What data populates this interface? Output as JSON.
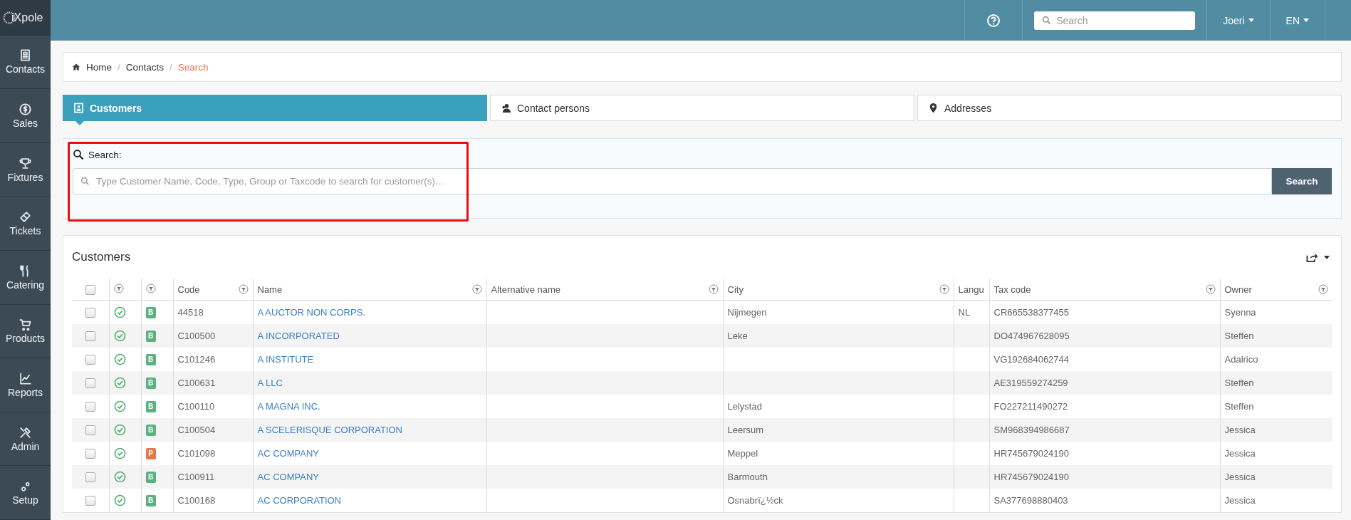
{
  "sidebar": {
    "logo": "iXpole",
    "items": [
      {
        "label": "Contacts"
      },
      {
        "label": "Sales"
      },
      {
        "label": "Fixtures"
      },
      {
        "label": "Tickets"
      },
      {
        "label": "Catering"
      },
      {
        "label": "Products"
      },
      {
        "label": "Reports"
      },
      {
        "label": "Admin"
      },
      {
        "label": "Setup"
      }
    ]
  },
  "topbar": {
    "search_placeholder": "Search",
    "user": "Joeri",
    "language": "EN"
  },
  "breadcrumb": [
    {
      "label": "Home",
      "selected": false
    },
    {
      "separator": "/",
      "label": "Contacts",
      "selected": false
    },
    {
      "separator": "/",
      "label": "Search",
      "selected": true
    }
  ],
  "tabs": [
    {
      "label": "Customers",
      "selected": true
    },
    {
      "label": "Contact persons",
      "selected": false
    },
    {
      "label": "Addresses",
      "selected": false
    }
  ],
  "search": {
    "label": "Search:",
    "placeholder": "Type Customer Name, Code, Type, Group or Taxcode to search for customer(s)...",
    "button": "Search"
  },
  "table": {
    "title": "Customers",
    "header_checked": false,
    "columns": [
      "Code",
      "Name",
      "Alternative name",
      "City",
      "Langu",
      "Tax code",
      "Owner"
    ],
    "rows": [
      {
        "checked": false,
        "type": {
          "label": "B",
          "color": "#5cb27f"
        },
        "code": "44518",
        "name": "A AUCTOR NON CORPS.",
        "alternative_name": "",
        "city": "Nijmegen",
        "language": "NL",
        "tax_code": "CR665538377455",
        "owner": "Syenna"
      },
      {
        "checked": false,
        "type": {
          "label": "B",
          "color": "#5cb27f"
        },
        "code": "C100500",
        "name": "A INCORPORATED",
        "alternative_name": "",
        "city": "Leke",
        "language": "",
        "tax_code": "DO474967628095",
        "owner": "Steffen"
      },
      {
        "checked": false,
        "type": {
          "label": "B",
          "color": "#5cb27f"
        },
        "code": "C101246",
        "name": "A INSTITUTE",
        "alternative_name": "",
        "city": "",
        "language": "",
        "tax_code": "VG192684062744",
        "owner": "Adalrico"
      },
      {
        "checked": false,
        "type": {
          "label": "B",
          "color": "#5cb27f"
        },
        "code": "C100631",
        "name": "A LLC",
        "alternative_name": "",
        "city": "",
        "language": "",
        "tax_code": "AE319559274259",
        "owner": "Steffen"
      },
      {
        "checked": false,
        "type": {
          "label": "B",
          "color": "#5cb27f"
        },
        "code": "C100110",
        "name": "A MAGNA INC.",
        "alternative_name": "",
        "city": "Lelystad",
        "language": "",
        "tax_code": "FO227211490272",
        "owner": "Steffen"
      },
      {
        "checked": false,
        "type": {
          "label": "B",
          "color": "#5cb27f"
        },
        "code": "C100504",
        "name": "A SCELERISQUE CORPORATION",
        "alternative_name": "",
        "city": "Leersum",
        "language": "",
        "tax_code": "SM968394986687",
        "owner": "Jessica"
      },
      {
        "checked": false,
        "type": {
          "label": "P",
          "color": "#e8794a"
        },
        "code": "C101098",
        "name": "AC COMPANY",
        "alternative_name": "",
        "city": "Meppel",
        "language": "",
        "tax_code": "HR745679024190",
        "owner": "Jessica"
      },
      {
        "checked": false,
        "type": {
          "label": "B",
          "color": "#5cb27f"
        },
        "code": "C100911",
        "name": "AC COMPANY",
        "alternative_name": "",
        "city": "Barmouth",
        "language": "",
        "tax_code": "HR745679024190",
        "owner": "Jessica"
      },
      {
        "checked": false,
        "type": {
          "label": "B",
          "color": "#5cb27f"
        },
        "code": "C100168",
        "name": "AC CORPORATION",
        "alternative_name": "",
        "city": "Osnabrï¿½ck",
        "language": "",
        "tax_code": "SA377698880403",
        "owner": "Jessica"
      }
    ]
  }
}
